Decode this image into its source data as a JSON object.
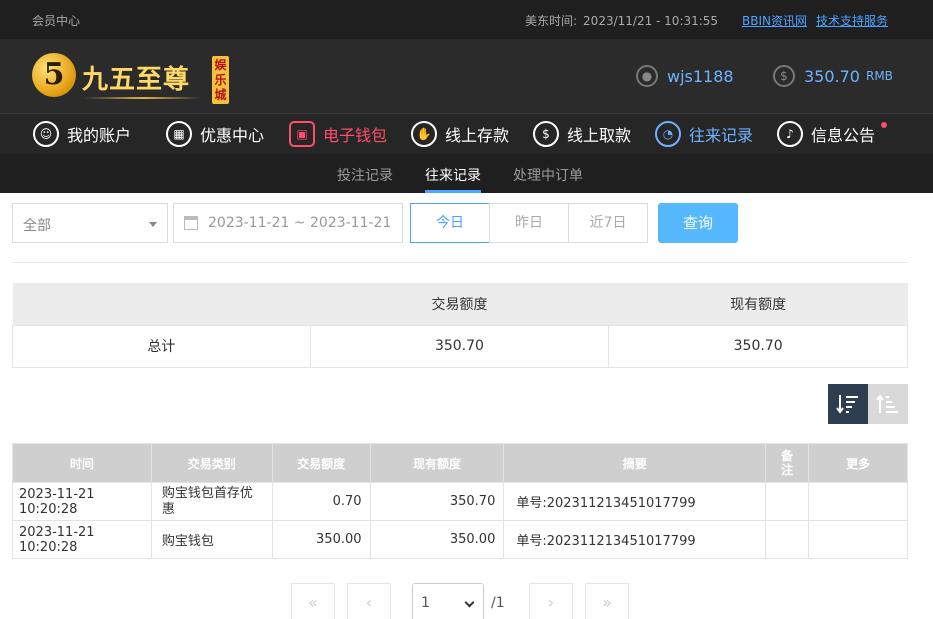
{
  "top_bar": {
    "member_center": "会员中心",
    "time_label": "美东时间:",
    "time_value": "2023/11/21 - 10:31:55",
    "link_news": "BBIN资讯网",
    "link_support": "技术支持服务"
  },
  "header": {
    "logo_digit": "5",
    "logo_text": "九五至尊",
    "logo_tag": "娱乐城",
    "username": "wjs1188",
    "balance": "350.70",
    "currency": "RMB"
  },
  "main_nav": [
    {
      "label": "我的账户",
      "icon": "user-icon"
    },
    {
      "label": "优惠中心",
      "icon": "gift-icon"
    },
    {
      "label": "电子钱包",
      "icon": "wallet-icon"
    },
    {
      "label": "线上存款",
      "icon": "deposit-icon"
    },
    {
      "label": "线上取款",
      "icon": "withdraw-icon"
    },
    {
      "label": "往来记录",
      "icon": "records-icon"
    },
    {
      "label": "信息公告",
      "icon": "bell-icon"
    }
  ],
  "sub_nav": [
    {
      "label": "投注记录"
    },
    {
      "label": "往来记录"
    },
    {
      "label": "处理中订单"
    }
  ],
  "filters": {
    "type_select": "全部",
    "date_range": "2023-11-21 ~ 2023-11-21",
    "today": "今日",
    "yesterday": "昨日",
    "last7": "近7日",
    "search": "查询"
  },
  "summary": {
    "headers": [
      "",
      "交易额度",
      "现有额度"
    ],
    "row": {
      "label": "总计",
      "transaction": "350.70",
      "balance": "350.70"
    }
  },
  "records": {
    "headers": [
      "时间",
      "交易类别",
      "交易额度",
      "现有额度",
      "摘要",
      "备注",
      "更多"
    ],
    "rows": [
      {
        "time": "2023-11-21 10:20:28",
        "category": "购宝钱包首存优惠",
        "amount": "0.70",
        "balance": "350.70",
        "summary": "单号:202311213451017799",
        "note": "",
        "more": ""
      },
      {
        "time": "2023-11-21 10:20:28",
        "category": "购宝钱包",
        "amount": "350.00",
        "balance": "350.00",
        "summary": "单号:202311213451017799",
        "note": "",
        "more": ""
      }
    ]
  },
  "pagination": {
    "first": "«",
    "prev": "‹",
    "page": "1",
    "total": "/1",
    "next": "›",
    "last": "»"
  }
}
